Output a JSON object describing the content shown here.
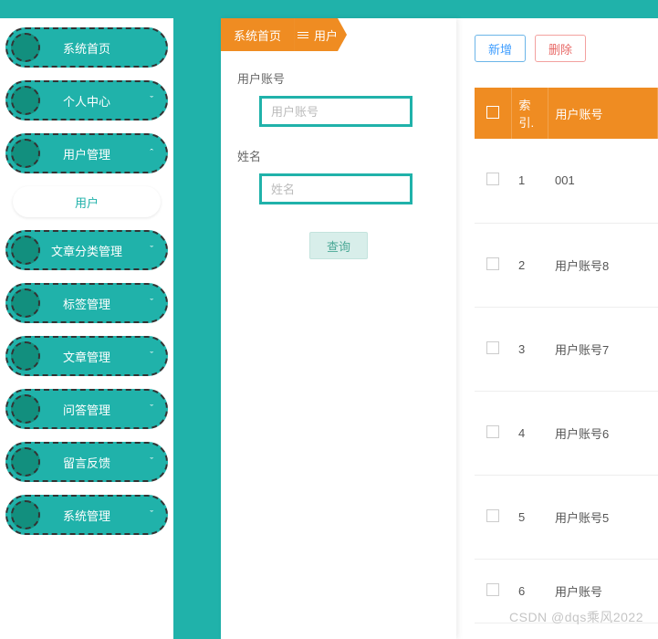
{
  "sidebar": {
    "items": [
      {
        "label": "系统首页",
        "expandable": false
      },
      {
        "label": "个人中心",
        "expandable": true
      },
      {
        "label": "用户管理",
        "expandable": true,
        "expanded": true
      },
      {
        "label": "文章分类管理",
        "expandable": true
      },
      {
        "label": "标签管理",
        "expandable": true
      },
      {
        "label": "文章管理",
        "expandable": true
      },
      {
        "label": "问答管理",
        "expandable": true
      },
      {
        "label": "留言反馈",
        "expandable": true
      },
      {
        "label": "系统管理",
        "expandable": true
      }
    ],
    "sub_item_label": "用户"
  },
  "breadcrumb": {
    "home": "系统首页",
    "current": "用户"
  },
  "search_form": {
    "account_label": "用户账号",
    "account_placeholder": "用户账号",
    "name_label": "姓名",
    "name_placeholder": "姓名",
    "search_button": "查询"
  },
  "actions": {
    "add": "新增",
    "delete": "删除"
  },
  "table": {
    "headers": {
      "index": "索引.",
      "account": "用户账号"
    },
    "rows": [
      {
        "index": "1",
        "account": "001"
      },
      {
        "index": "2",
        "account": "用户账号8"
      },
      {
        "index": "3",
        "account": "用户账号7"
      },
      {
        "index": "4",
        "account": "用户账号6"
      },
      {
        "index": "5",
        "account": "用户账号5"
      },
      {
        "index": "6",
        "account": "用户账号"
      }
    ]
  },
  "watermark": "CSDN @dqs乘风2022"
}
